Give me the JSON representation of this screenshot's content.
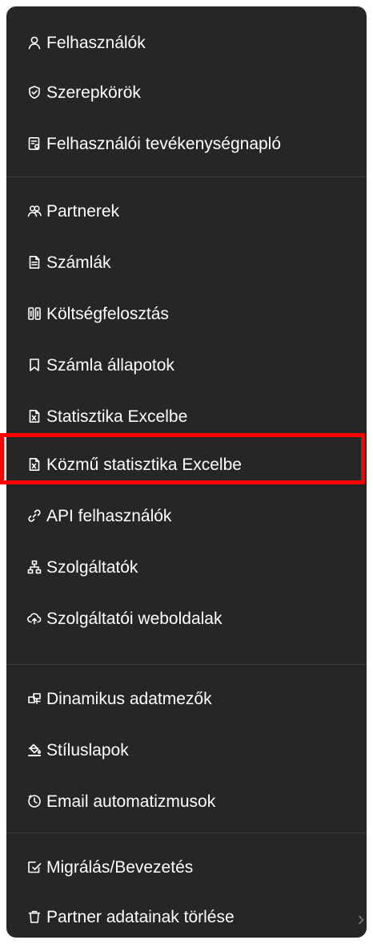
{
  "menu": {
    "items": [
      {
        "label": "Felhasználók",
        "icon": "user-icon"
      },
      {
        "label": "Szerepkörök",
        "icon": "shield-check-icon"
      },
      {
        "label": "Felhasználói tevékenységnapló",
        "icon": "activity-log-icon"
      },
      {
        "label": "Partnerek",
        "icon": "users-icon"
      },
      {
        "label": "Számlák",
        "icon": "invoice-icon"
      },
      {
        "label": "Költségfelosztás",
        "icon": "split-columns-icon"
      },
      {
        "label": "Számla állapotok",
        "icon": "bookmark-icon"
      },
      {
        "label": "Statisztika Excelbe",
        "icon": "excel-file-icon"
      },
      {
        "label": "Közmű statisztika Excelbe",
        "icon": "excel-file-icon"
      },
      {
        "label": "API felhasználók",
        "icon": "api-link-icon"
      },
      {
        "label": "Szolgáltatók",
        "icon": "sitemap-icon"
      },
      {
        "label": "Szolgáltatói weboldalak",
        "icon": "cloud-upload-icon"
      },
      {
        "label": "Dinamikus adatmezők",
        "icon": "dynamic-fields-icon"
      },
      {
        "label": "Stíluslapok",
        "icon": "paint-bucket-icon"
      },
      {
        "label": "Email automatizmusok",
        "icon": "clock-icon"
      },
      {
        "label": "Migrálás/Bevezetés",
        "icon": "checkbox-edit-icon"
      },
      {
        "label": "Partner adatainak törlése",
        "icon": "trash-icon"
      }
    ],
    "highlighted_item": "Közmű statisztika Excelbe",
    "highlight_color": "#ff0000",
    "background_color": "#262626"
  }
}
